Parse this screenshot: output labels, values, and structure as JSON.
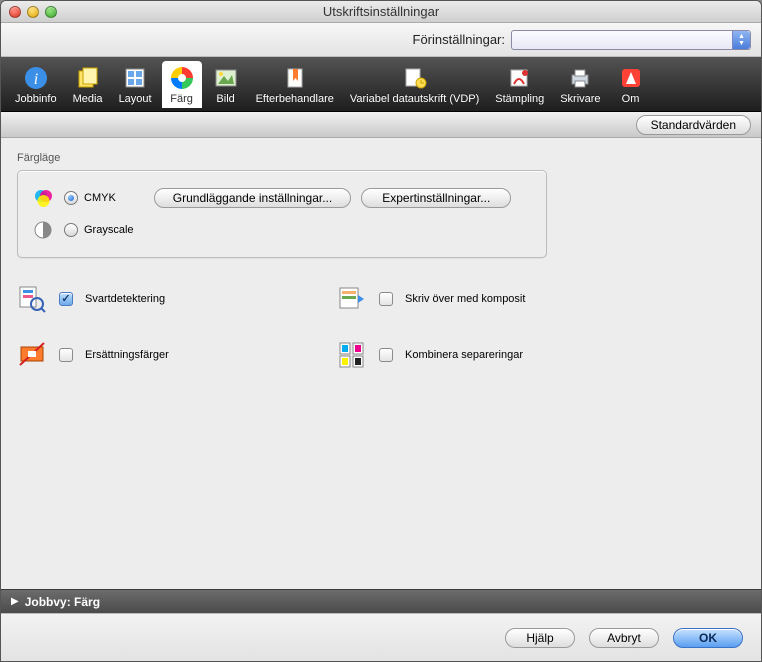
{
  "window": {
    "title": "Utskriftsinställningar"
  },
  "presets": {
    "label": "Förinställningar:",
    "value": ""
  },
  "tabs": [
    {
      "id": "jobinfo",
      "label": "Jobbinfo"
    },
    {
      "id": "media",
      "label": "Media"
    },
    {
      "id": "layout",
      "label": "Layout"
    },
    {
      "id": "color",
      "label": "Färg",
      "active": true
    },
    {
      "id": "image",
      "label": "Bild"
    },
    {
      "id": "finishing",
      "label": "Efterbehandlare"
    },
    {
      "id": "vdp",
      "label": "Variabel datautskrift (VDP)"
    },
    {
      "id": "stamping",
      "label": "Stämpling"
    },
    {
      "id": "printer",
      "label": "Skrivare"
    },
    {
      "id": "about",
      "label": "Om"
    }
  ],
  "subbar": {
    "defaults": "Standardvärden"
  },
  "colorMode": {
    "title": "Färgläge",
    "cmyk": "CMYK",
    "grayscale": "Grayscale",
    "selected": "cmyk",
    "basic": "Grundläggande inställningar...",
    "expert": "Expertinställningar..."
  },
  "checks": {
    "blackDetect": {
      "label": "Svartdetektering",
      "checked": true
    },
    "compositeOver": {
      "label": "Skriv över med komposit",
      "checked": false
    },
    "subColors": {
      "label": "Ersättningsfärger",
      "checked": false
    },
    "combineSeps": {
      "label": "Kombinera separeringar",
      "checked": false
    }
  },
  "footer": {
    "text": "Jobbvy: Färg"
  },
  "buttons": {
    "help": "Hjälp",
    "cancel": "Avbryt",
    "ok": "OK"
  }
}
